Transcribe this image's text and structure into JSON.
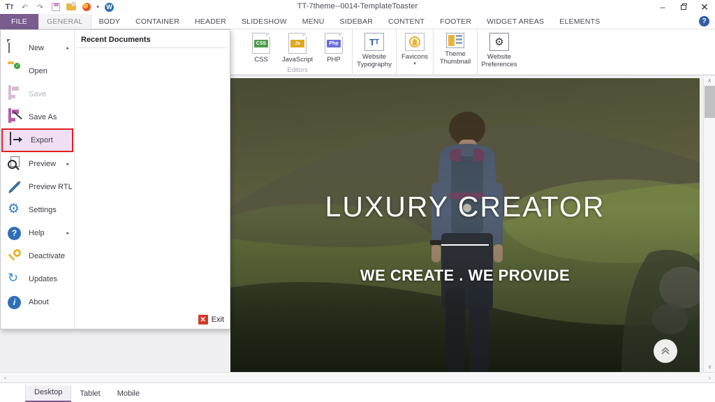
{
  "window": {
    "title": "TT-7theme--0014-TemplateToaster",
    "minimize_label": "–",
    "restore_label": "❐",
    "close_label": "✕",
    "help_label": "?"
  },
  "quick_access": [
    {
      "name": "typography-icon",
      "glyph": "Tᴛ"
    },
    {
      "name": "undo-icon",
      "glyph": "↶"
    },
    {
      "name": "redo-icon",
      "glyph": "↷"
    },
    {
      "name": "save-icon",
      "glyph": "Ὃe"
    },
    {
      "name": "open-folder-icon",
      "glyph": "📂"
    },
    {
      "name": "browser-preview-icon",
      "glyph": "◉"
    },
    {
      "name": "browser-dropdown-icon",
      "glyph": "▾"
    },
    {
      "name": "wordpress-icon",
      "glyph": "Ⓦ"
    }
  ],
  "ribbon_tabs": [
    {
      "label": "FILE",
      "state": "file"
    },
    {
      "label": "GENERAL",
      "state": "active"
    },
    {
      "label": "BODY",
      "state": "normal"
    },
    {
      "label": "CONTAINER",
      "state": "normal"
    },
    {
      "label": "HEADER",
      "state": "normal"
    },
    {
      "label": "SLIDESHOW",
      "state": "normal"
    },
    {
      "label": "MENU",
      "state": "normal"
    },
    {
      "label": "SIDEBAR",
      "state": "normal"
    },
    {
      "label": "CONTENT",
      "state": "normal"
    },
    {
      "label": "FOOTER",
      "state": "normal"
    },
    {
      "label": "WIDGET AREAS",
      "state": "normal"
    },
    {
      "label": "ELEMENTS",
      "state": "normal"
    }
  ],
  "ribbon": {
    "editors_group_label": "Editors",
    "editors": [
      {
        "label": "CSS",
        "badge": "CSS",
        "icon": "css-file-icon"
      },
      {
        "label": "JavaScript",
        "badge": "Js",
        "icon": "javascript-file-icon"
      },
      {
        "label": "PHP",
        "badge": "Php",
        "icon": "php-file-icon"
      }
    ],
    "tools": [
      {
        "label_line1": "Website",
        "label_line2": "Typography",
        "icon": "website-typography-icon",
        "glyph": "Tᴛ"
      },
      {
        "label_line1": "Favicons",
        "label_line2": "",
        "icon": "favicons-icon",
        "has_caret": true
      },
      {
        "label_line1": "Theme",
        "label_line2": "Thumbnail",
        "icon": "theme-thumbnail-icon"
      },
      {
        "label_line1": "Website",
        "label_line2": "Preferences",
        "icon": "website-preferences-icon",
        "glyph": "⚙"
      }
    ]
  },
  "file_menu": {
    "items": [
      {
        "label": "New",
        "icon": "new-document-icon",
        "submenu": true,
        "disabled": false,
        "highlight": false
      },
      {
        "label": "Open",
        "icon": "open-folder-icon",
        "submenu": false,
        "disabled": false,
        "highlight": false
      },
      {
        "label": "Save",
        "icon": "save-disk-icon",
        "submenu": false,
        "disabled": true,
        "highlight": false
      },
      {
        "label": "Save As",
        "icon": "save-as-icon",
        "submenu": false,
        "disabled": false,
        "highlight": false
      },
      {
        "label": "Export",
        "icon": "export-icon",
        "submenu": false,
        "disabled": false,
        "highlight": true
      },
      {
        "label": "Preview",
        "icon": "preview-magnifier-icon",
        "submenu": true,
        "disabled": false,
        "highlight": false
      },
      {
        "label": "Preview RTL",
        "icon": "preview-rtl-icon",
        "submenu": false,
        "disabled": false,
        "highlight": false
      },
      {
        "label": "Settings",
        "icon": "settings-gear-icon",
        "submenu": false,
        "disabled": false,
        "highlight": false
      },
      {
        "label": "Help",
        "icon": "help-question-icon",
        "submenu": true,
        "disabled": false,
        "highlight": false
      },
      {
        "label": "Deactivate",
        "icon": "deactivate-key-icon",
        "submenu": false,
        "disabled": false,
        "highlight": false
      },
      {
        "label": "Updates",
        "icon": "updates-refresh-icon",
        "submenu": false,
        "disabled": false,
        "highlight": false
      },
      {
        "label": "About",
        "icon": "about-info-icon",
        "submenu": false,
        "disabled": false,
        "highlight": false
      }
    ],
    "recent_documents_title": "Recent Documents",
    "recent_documents": [],
    "exit_label": "Exit"
  },
  "preview": {
    "hero_title": "LUXURY CREATOR",
    "hero_subtitle": "WE CREATE  .  WE PROVIDE",
    "scroll_top_glyph": "»",
    "scroll_up_arrow": "∧",
    "scroll_down_arrow": "∨",
    "scroll_left_arrow": "‹",
    "scroll_right_arrow": "›"
  },
  "status_bar": {
    "device_tabs": [
      {
        "label": "Desktop",
        "active": true
      },
      {
        "label": "Tablet",
        "active": false
      },
      {
        "label": "Mobile",
        "active": false
      }
    ]
  },
  "colors": {
    "file_tab": "#7a5c8e",
    "highlight_border": "#e02020",
    "highlight_fill": "#efdef4",
    "accent_blue": "#2f6fb8"
  }
}
